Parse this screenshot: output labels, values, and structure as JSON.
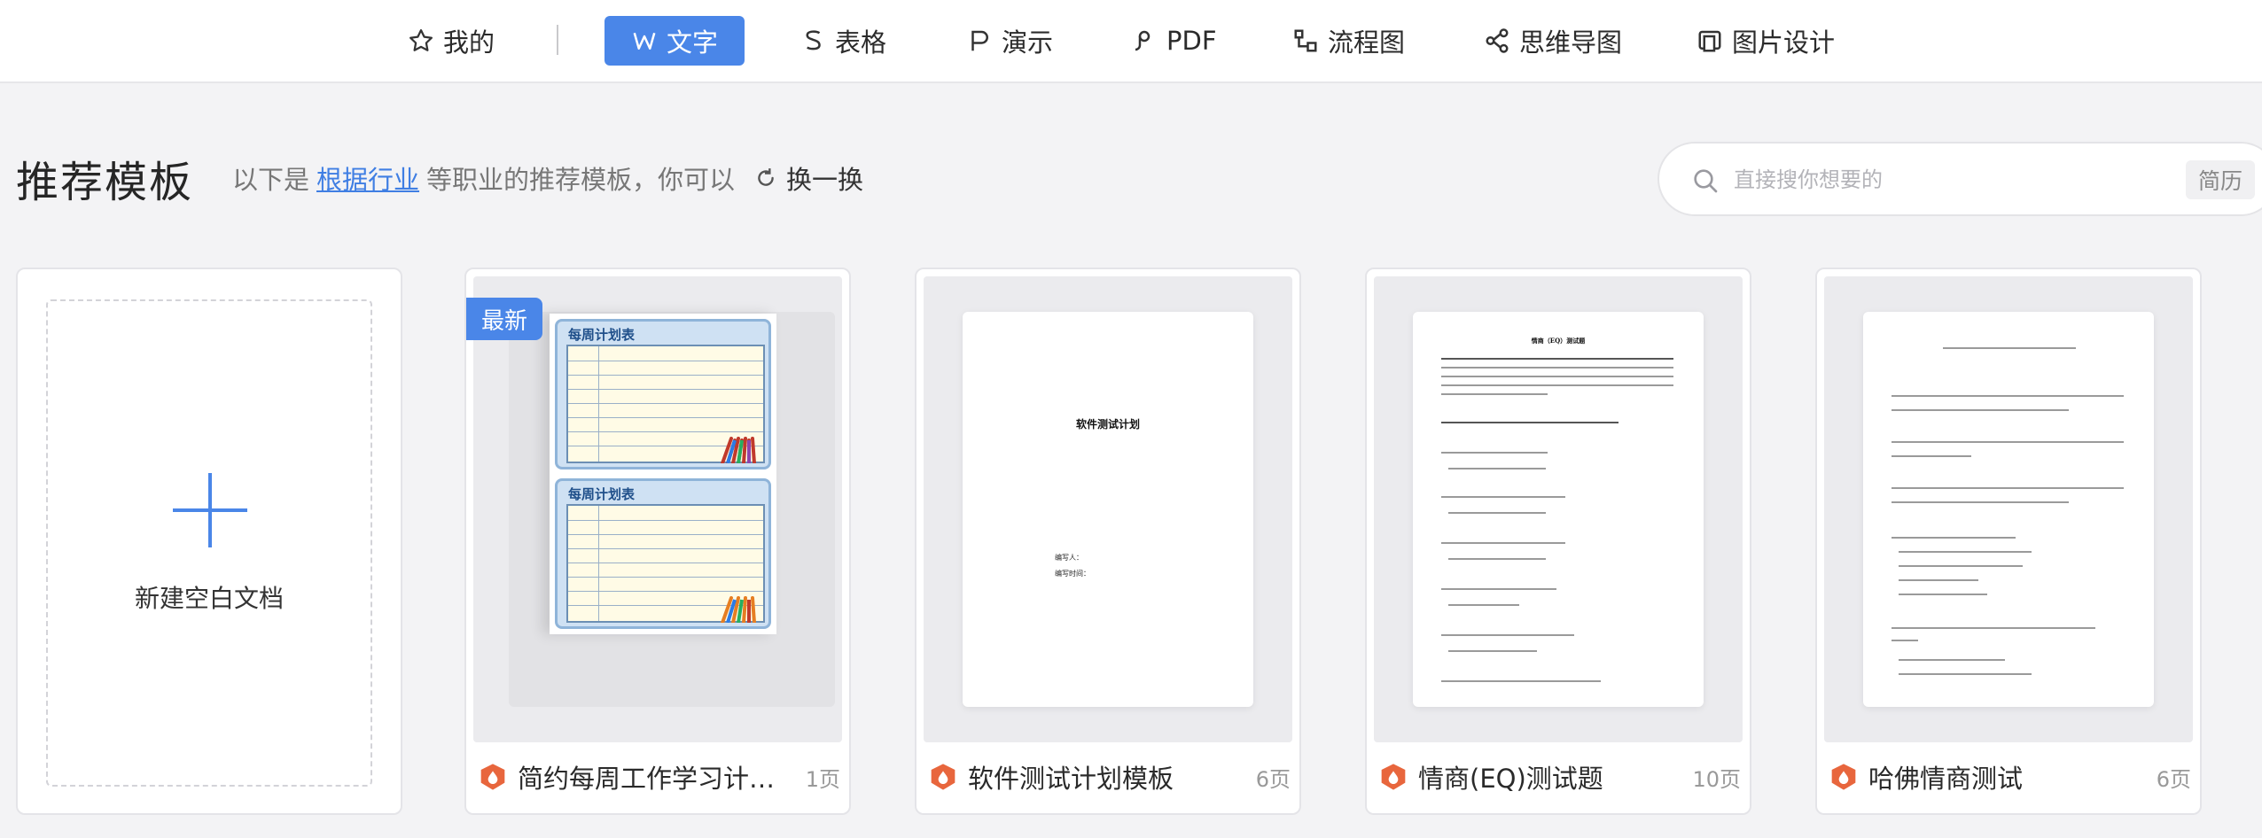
{
  "nav": {
    "items": [
      {
        "label": "我的",
        "icon": "star-icon"
      },
      {
        "label": "文字",
        "icon": "word-icon",
        "active": true
      },
      {
        "label": "表格",
        "icon": "sheet-icon"
      },
      {
        "label": "演示",
        "icon": "slides-icon"
      },
      {
        "label": "PDF",
        "icon": "pdf-icon"
      },
      {
        "label": "流程图",
        "icon": "flowchart-icon"
      },
      {
        "label": "思维导图",
        "icon": "mindmap-icon"
      },
      {
        "label": "图片设计",
        "icon": "image-design-icon"
      }
    ]
  },
  "header": {
    "title": "推荐模板",
    "subtitle_prefix": "以下是",
    "subtitle_link": "根据行业",
    "subtitle_suffix": "等职业的推荐模板，你可以",
    "refresh_label": "换一换"
  },
  "search": {
    "placeholder": "直接搜你想要的",
    "tag": "简历"
  },
  "new_blank": {
    "label": "新建空白文档"
  },
  "templates": [
    {
      "name": "简约每周工作学习计…",
      "pages": "1页",
      "badge": "最新",
      "plan_title": "每周计划表"
    },
    {
      "name": "软件测试计划模板",
      "pages": "6页",
      "doc_title": "软件测试计划",
      "doc_field1": "编写人：",
      "doc_field2": "编写时间："
    },
    {
      "name": "情商(EQ)测试题",
      "pages": "10页",
      "doc_title": "情商（EQ）测试题"
    },
    {
      "name": "哈佛情商测试",
      "pages": "6页"
    }
  ],
  "colors": {
    "accent": "#4a86e8",
    "app_icon": "#e8663d"
  }
}
